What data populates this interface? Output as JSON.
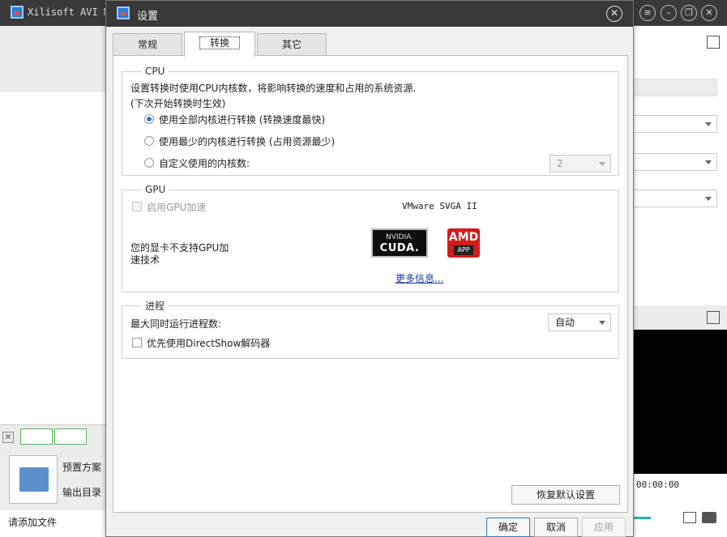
{
  "app": {
    "title": "Xilisoft AVI MPEG",
    "profile_label": "预置方案",
    "output_label": "输出目录",
    "add_files_hint": "请添加文件",
    "time": "00:00:00"
  },
  "dialog": {
    "title": "设置",
    "tabs": [
      "常规",
      "转换",
      "其它"
    ],
    "cpu": {
      "legend": "CPU",
      "desc1": "设置转换时使用CPU内核数，将影响转换的速度和占用的系统资源.",
      "desc2": "(下次开始转换时生效)",
      "options": [
        "使用全部内核进行转换 (转换速度最快)",
        "使用最少的内核进行转换 (占用资源最少)",
        "自定义使用的内核数:"
      ],
      "custom_value": "2"
    },
    "gpu": {
      "legend": "GPU",
      "enable_label": "启用GPU加速",
      "adapter": "VMware SVGA II",
      "nvidia_l1": "NVIDIA.",
      "nvidia_l2": "CUDA.",
      "amd_l1": "AMD",
      "amd_l2": "APP",
      "unsupported": "您的显卡不支持GPU加速技术",
      "more_info": "更多信息..."
    },
    "process": {
      "legend": "进程",
      "max_label": "最大同时运行进程数:",
      "max_value": "自动",
      "directshow_label": "优先使用DirectShow解码器"
    },
    "buttons": {
      "restore": "恢复默认设置",
      "ok": "确定",
      "cancel": "取消",
      "apply": "应用"
    }
  }
}
